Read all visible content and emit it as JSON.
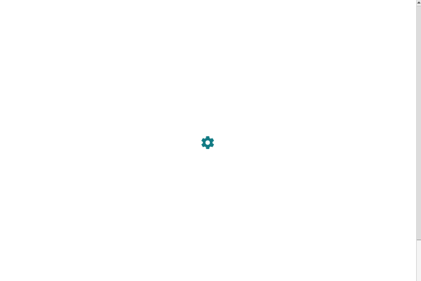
{
  "loader": {
    "icon": "gear-icon",
    "color": "#127b84"
  },
  "scrollbar": {
    "up_arrow_icon": "triangle-up-icon",
    "position_fraction": 0.0,
    "thumb_fraction": 0.85
  },
  "colors": {
    "background": "#ffffff",
    "scrollbar_track": "#f0f0f0",
    "scrollbar_thumb": "#dcdcdc"
  }
}
